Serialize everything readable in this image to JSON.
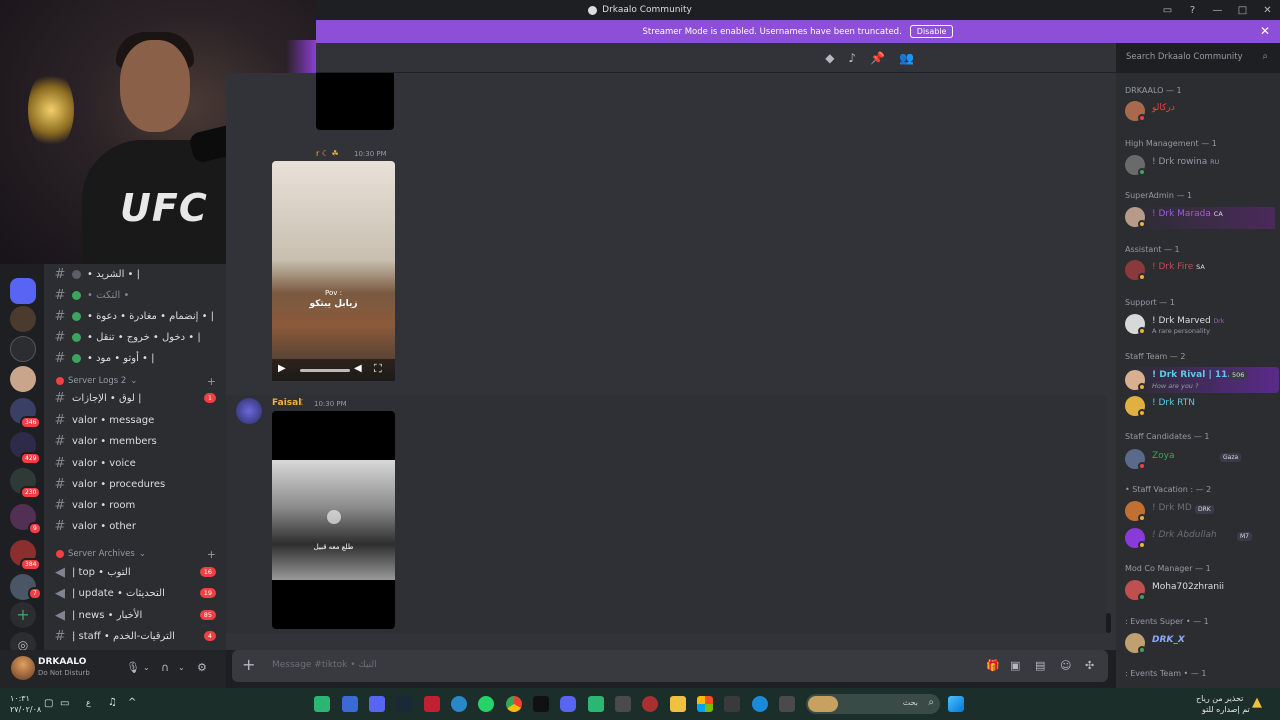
{
  "window": {
    "title": "Drkaalo Community"
  },
  "streamer_bar": {
    "text": "Streamer Mode is enabled. Usernames have been truncated.",
    "button": "Disable"
  },
  "search": {
    "placeholder": "Search Drkaalo Community"
  },
  "channels": [
    {
      "name": "• الشريد • |",
      "status": "grey"
    },
    {
      "name": "• التكت •",
      "status": "green"
    },
    {
      "name": "• إنضمام • مغادرة • دعوة • |",
      "status": "green"
    },
    {
      "name": "• دخول • خروج • تنقل • |",
      "status": "green"
    },
    {
      "name": "• أوتو • مود • |",
      "status": "green"
    }
  ],
  "category_logs": {
    "label": "Server Logs 2"
  },
  "log_channels": [
    {
      "name": "لوق • الإجازات |",
      "count": "1"
    },
    {
      "name": "valor • message",
      "count": ""
    },
    {
      "name": "valor • members",
      "count": ""
    },
    {
      "name": "valor • voice",
      "count": ""
    },
    {
      "name": "valor • procedures",
      "count": ""
    },
    {
      "name": "valor • room",
      "count": ""
    },
    {
      "name": "valor • other",
      "count": ""
    }
  ],
  "category_archives": {
    "label": "Server Archives"
  },
  "archive_channels": [
    {
      "name": "| top • التوب",
      "count": "16"
    },
    {
      "name": "| update • التحديثات",
      "count": "19"
    },
    {
      "name": "| news • الأخبار",
      "count": "85"
    },
    {
      "name": "| staff • الترقيات-الخدم",
      "count": "4"
    }
  ],
  "server_badges": [
    "346",
    "429",
    "230",
    "9",
    "384",
    "7"
  ],
  "user": {
    "name": "DRKAALO",
    "status": "Do Not Disturb"
  },
  "messages": [
    {
      "time": "10:30 PM",
      "author": ""
    },
    {
      "caption_top": "Pov :",
      "caption": "زيابل يبتكو"
    },
    {
      "author": "Faisal",
      "time": "10:30 PM",
      "caption": "طلع معه قبيل"
    }
  ],
  "composer": {
    "placeholder": "Message #tiktok • التيك"
  },
  "members": [
    {
      "role": "DRKAALO — 1",
      "name": "دركالو",
      "sub": "",
      "color": "#f23f43"
    },
    {
      "role": "High Management — 1",
      "name": "! Drk rowina",
      "sub": "",
      "color": "#949ba4"
    },
    {
      "role": "SuperAdmin — 1",
      "name": "! Drk Marada",
      "sub": "",
      "color": "#a05ad8"
    },
    {
      "role": "Assistant — 1",
      "name": "! Drk Fire",
      "sub": "",
      "color": "#c0504d"
    },
    {
      "role": "Support — 1",
      "name": "! Drk Marved",
      "sub": "A rare personality",
      "color": "#dbdee1"
    },
    {
      "role": "Staff Team — 2",
      "name": "! Drk Rival | 11...",
      "sub": "How are you ?",
      "color": "#5ec8e5"
    },
    {
      "role": "",
      "name": "! Drk RTN",
      "sub": "",
      "color": "#5ec8e5"
    },
    {
      "role": "Staff Candidates — 1",
      "name": "Zoya",
      "sub": "",
      "color": "#3ba55d"
    },
    {
      "role": "• Staff Vacation : — 2",
      "name": "! Drk MD",
      "sub": "",
      "color": "#6d6f78"
    },
    {
      "role": "",
      "name": "! Drk Abdullah",
      "sub": "",
      "color": "#6d6f78"
    },
    {
      "role": "Mod Co Manager — 1",
      "name": "Moha702zhranii",
      "sub": "",
      "color": "#dbdee1"
    },
    {
      "role": ": Events Super • — 1",
      "name": "DRK_X",
      "sub": "",
      "color": "#8fa8ff"
    },
    {
      "role": ": Events Team • — 1",
      "name": "",
      "sub": "",
      "color": "#dbdee1"
    }
  ],
  "member_tags": {
    "rival_badge": "506",
    "md_tag": "DRK",
    "abdullah_tag": "M7",
    "zoya_tag": "Gaza",
    "rowina_tag": "RU",
    "marada_tag": "CA",
    "fire_tag": "SA",
    "marved_tag": "Drk"
  },
  "taskbar": {
    "lang": "ع",
    "time": "١٠:٣١",
    "date": "٢٧/٠٢/٠٨",
    "search": "بحث",
    "notice_1": "تحذير من رياح",
    "notice_2": "تم إصداره للتو"
  }
}
